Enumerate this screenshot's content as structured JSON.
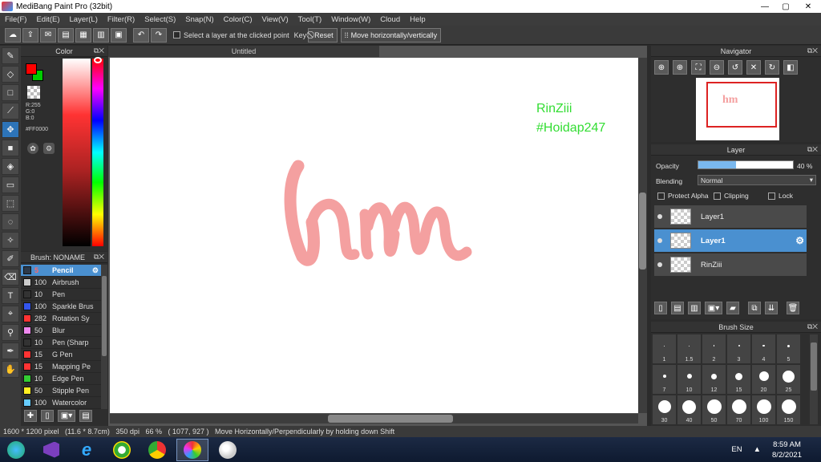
{
  "window": {
    "title": "MediBang Paint Pro (32bit)",
    "minimize": "—",
    "maximize": "▢",
    "close": "✕"
  },
  "menu": [
    "File(F)",
    "Edit(E)",
    "Layer(L)",
    "Filter(R)",
    "Select(S)",
    "Snap(N)",
    "Color(C)",
    "View(V)",
    "Tool(T)",
    "Window(W)",
    "Cloud",
    "Help"
  ],
  "toolbar": {
    "select_layer_label": "Select a layer at the clicked point",
    "key_label": "Key",
    "reset_label": "Reset",
    "move_label": "Move horizontally/vertically"
  },
  "color_panel": {
    "title": "Color",
    "r": "R:255",
    "g": "G:0",
    "b": "B:0",
    "hex": "#FF0000",
    "fg_color": "#FF0000",
    "bg_color": "#00CC00"
  },
  "brush_panel": {
    "title": "Brush: NONAME",
    "items": [
      {
        "size": "5",
        "name": "Pencil",
        "color": "#2d3a4a"
      },
      {
        "size": "100",
        "name": "Airbrush",
        "color": "#cccccc"
      },
      {
        "size": "10",
        "name": "Pen",
        "color": "#333333"
      },
      {
        "size": "100",
        "name": "Sparkle Brus",
        "color": "#3355ee"
      },
      {
        "size": "282",
        "name": "Rotation Sy",
        "color": "#ff3333"
      },
      {
        "size": "50",
        "name": "Blur",
        "color": "#ee88ee"
      },
      {
        "size": "10",
        "name": "Pen (Sharp",
        "color": "#333333"
      },
      {
        "size": "15",
        "name": "G Pen",
        "color": "#ff3333"
      },
      {
        "size": "15",
        "name": "Mapping Pe",
        "color": "#ff3333"
      },
      {
        "size": "10",
        "name": "Edge Pen",
        "color": "#33cc33"
      },
      {
        "size": "50",
        "name": "Stipple Pen",
        "color": "#ffee22"
      },
      {
        "size": "100",
        "name": "Watercolor",
        "color": "#66ccff"
      }
    ]
  },
  "canvas": {
    "tab_title": "Untitled",
    "watermark_line1": "RinZiii",
    "watermark_line2": "#Hoidap247",
    "watermark_color": "#33dd33",
    "drawing_color": "#f4a0a0"
  },
  "navigator": {
    "title": "Navigator"
  },
  "layer_panel": {
    "title": "Layer",
    "opacity_label": "Opacity",
    "opacity_value": "40 %",
    "opacity_fraction": 0.4,
    "blending_label": "Blending",
    "blending_value": "Normal",
    "protect_alpha": "Protect Alpha",
    "clipping": "Clipping",
    "lock": "Lock",
    "layers": [
      {
        "name": "Layer1",
        "selected": false
      },
      {
        "name": "Layer1",
        "selected": true
      },
      {
        "name": "RinZiii",
        "selected": false
      }
    ]
  },
  "brush_size": {
    "title": "Brush Size",
    "sizes": [
      "1",
      "1.5",
      "2",
      "3",
      "4",
      "5",
      "7",
      "10",
      "12",
      "15",
      "20",
      "25",
      "30",
      "40",
      "50",
      "70",
      "100",
      "150"
    ]
  },
  "status": {
    "text": "1600 * 1200 pixel   (11.6 * 8.7cm)   350 dpi   66 %   ( 1077, 927 )   Move Horizontally/Perpendicularly by holding down Shift"
  },
  "taskbar": {
    "lang": "EN",
    "time": "8:59 AM",
    "date": "8/2/2021"
  }
}
